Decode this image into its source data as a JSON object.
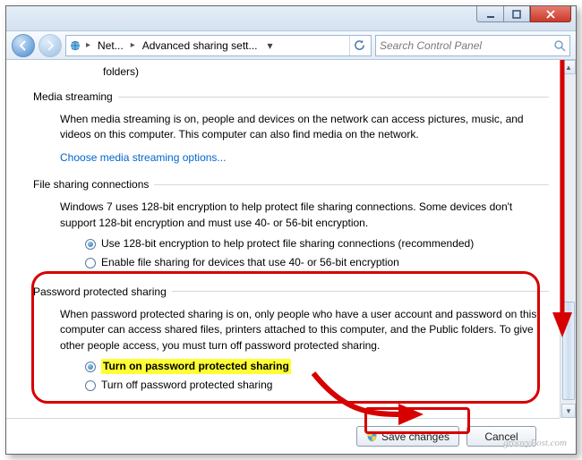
{
  "breadcrumb": {
    "seg1": "Net...",
    "seg2": "Advanced sharing sett..."
  },
  "search": {
    "placeholder": "Search Control Panel"
  },
  "fragment_top": "folders)",
  "section_media": {
    "title": "Media streaming",
    "body": "When media streaming is on, people and devices on the network can access pictures, music, and videos on this computer. This computer can also find media on the network.",
    "link": "Choose media streaming options..."
  },
  "section_file": {
    "title": "File sharing connections",
    "body": "Windows 7 uses 128-bit encryption to help protect file sharing connections. Some devices don't support 128-bit encryption and must use 40- or 56-bit encryption.",
    "opt1": "Use 128-bit encryption to help protect file sharing connections (recommended)",
    "opt2": "Enable file sharing for devices that use 40- or 56-bit encryption"
  },
  "section_pwd": {
    "title": "Password protected sharing",
    "body": "When password protected sharing is on, only people who have a user account and password on this computer can access shared files, printers attached to this computer, and the Public folders. To give other people access, you must turn off password protected sharing.",
    "opt1": "Turn on password protected sharing",
    "opt2": "Turn off password protected sharing"
  },
  "buttons": {
    "save": "Save changes",
    "cancel": "Cancel"
  },
  "watermark": "groovyPost.com"
}
